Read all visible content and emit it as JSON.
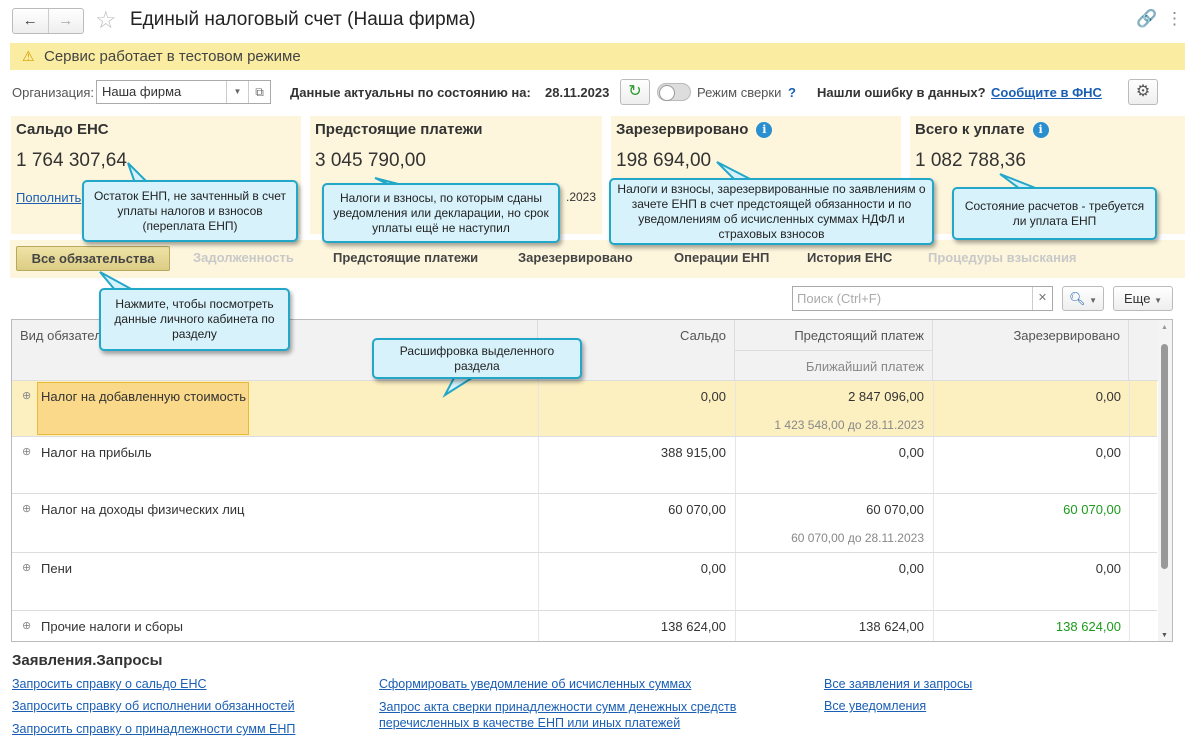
{
  "window": {
    "title": "Единый налоговый счет (Наша фирма)",
    "back": "←",
    "forward": "→"
  },
  "banner": {
    "text": "Сервис работает в тестовом режиме"
  },
  "toolbar": {
    "org_label": "Организация:",
    "org_value": "Наша фирма",
    "actual_label": "Данные актуальны по состоянию на:",
    "actual_date": "28.11.2023",
    "mode_label": "Режим сверки",
    "mode_help": "?",
    "error_label": "Нашли ошибку в данных?",
    "error_link": "Сообщите в ФНС"
  },
  "cards": [
    {
      "title": "Сальдо ЕНС",
      "value": "1 764 307,64",
      "link": "Пополнить"
    },
    {
      "title": "Предстоящие платежи",
      "value": "3 045 790,00",
      "note": ".2023"
    },
    {
      "title": "Зарезервировано",
      "value": "198 694,00",
      "value_color": "#1b9b1b"
    },
    {
      "title": "Всего к уплате",
      "value": "1 082 788,36"
    }
  ],
  "tabs": [
    {
      "label": "Все обязательства",
      "state": "active"
    },
    {
      "label": "Задолженность",
      "state": "disabled"
    },
    {
      "label": "Предстоящие платежи",
      "state": "enabled"
    },
    {
      "label": "Зарезервировано",
      "state": "enabled"
    },
    {
      "label": "Операции ЕНП",
      "state": "enabled"
    },
    {
      "label": "История ЕНС",
      "state": "enabled"
    },
    {
      "label": "Процедуры взыскания",
      "state": "disabled"
    }
  ],
  "search": {
    "placeholder": "Поиск (Ctrl+F)",
    "more": "Еще"
  },
  "table": {
    "headers": {
      "name": "Вид обязател",
      "saldo": "Сальдо",
      "upcoming": "Предстоящий платеж",
      "nearest": "Ближайший платеж",
      "reserved": "Зарезервировано"
    },
    "rows": [
      {
        "name": "Налог на добавленную стоимость",
        "saldo": "0,00",
        "upcoming": "2 847 096,00",
        "nearest": "1 423 548,00 до 28.11.2023",
        "reserved": "0,00",
        "selected": true
      },
      {
        "name": "Налог на прибыль",
        "saldo": "388 915,00",
        "upcoming": "0,00",
        "nearest": "",
        "reserved": "0,00"
      },
      {
        "name": "Налог на доходы физических лиц",
        "saldo": "60 070,00",
        "upcoming": "60 070,00",
        "nearest": "60 070,00 до 28.11.2023",
        "reserved": "60 070,00"
      },
      {
        "name": "Пени",
        "saldo": "0,00",
        "upcoming": "0,00",
        "nearest": "",
        "reserved": "0,00"
      },
      {
        "name": "Прочие налоги и сборы",
        "saldo": "138 624,00",
        "upcoming": "138 624,00",
        "nearest": "",
        "reserved": "138 624,00"
      }
    ]
  },
  "tooltips": [
    "Остаток ЕНП, не зачтенный в счет уплаты налогов и взносов (переплата ЕНП)",
    "Налоги и взносы, по которым сданы уведомления или декларации, но срок уплаты ещё не наступил",
    "Налоги и взносы, зарезервированные по заявлениям о зачете ЕНП в счет предстоящей обязанности и по уведомлениям об исчисленных суммах НДФЛ и страховых взносов",
    "Состояние расчетов - требуется ли уплата ЕНП",
    "Нажмите, чтобы посмотреть данные личного кабинета по разделу",
    "Расшифровка выделенного раздела"
  ],
  "requests": {
    "title": "Заявления.Запросы",
    "links": [
      "Запросить справку о сальдо ЕНС",
      "Запросить справку об исполнении обязанностей",
      "Запросить справку о принадлежности сумм ЕНП",
      "Сформировать уведомление об исчисленных суммах",
      "Запрос акта сверки принадлежности сумм денежных средств перечисленных в качестве ЕНП или иных платежей",
      "Все заявления и запросы",
      "Все уведомления"
    ]
  }
}
